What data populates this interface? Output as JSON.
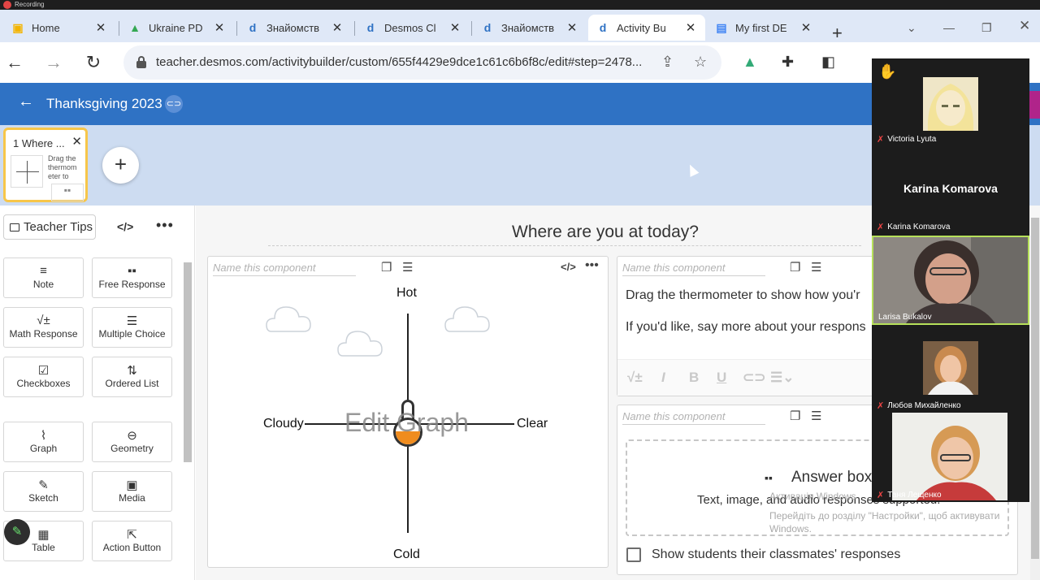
{
  "recording": {
    "label": "Recording"
  },
  "tabs": [
    {
      "label": "Home",
      "favicon": "classroom-icon",
      "color": "#f4b400"
    },
    {
      "label": "Ukraine PD",
      "favicon": "drive-icon",
      "color": "#34a853"
    },
    {
      "label": "Знайомств",
      "favicon": "desmos-icon",
      "color": "#2f72c4"
    },
    {
      "label": "Desmos Cl",
      "favicon": "desmos-icon",
      "color": "#2f72c4"
    },
    {
      "label": "Знайомств",
      "favicon": "desmos-icon",
      "color": "#2f72c4"
    },
    {
      "label": "Activity Bu",
      "favicon": "desmos-icon",
      "color": "#2f72c4",
      "active": true
    },
    {
      "label": "My first DE",
      "favicon": "docs-icon",
      "color": "#4285f4"
    }
  ],
  "browser": {
    "url": "teacher.desmos.com/activitybuilder/custom/655f4429e9dce1c61c6b6f8c/edit#step=2478..."
  },
  "header": {
    "title": "Thanksgiving 2023"
  },
  "screens": [
    {
      "number": "1",
      "title": "Where ...",
      "preview_text": "Drag the thermom eter to"
    }
  ],
  "leftpanel": {
    "teacher_tips": "Teacher Tips",
    "code_icon": "</>",
    "more_icon": "•••",
    "components": [
      {
        "label": "Note",
        "icon": "note-icon",
        "glyph": "≡"
      },
      {
        "label": "Free Response",
        "icon": "free-response-icon",
        "glyph": "▪▪"
      },
      {
        "label": "Math Response",
        "icon": "math-response-icon",
        "glyph": "√±"
      },
      {
        "label": "Multiple Choice",
        "icon": "multiple-choice-icon",
        "glyph": "☰"
      },
      {
        "label": "Checkboxes",
        "icon": "checkboxes-icon",
        "glyph": "☑"
      },
      {
        "label": "Ordered List",
        "icon": "ordered-list-icon",
        "glyph": "⇅"
      },
      {
        "label": "Graph",
        "icon": "graph-icon",
        "glyph": "📈"
      },
      {
        "label": "Geometry",
        "icon": "geometry-icon",
        "glyph": "⊖"
      },
      {
        "label": "Sketch",
        "icon": "sketch-icon",
        "glyph": "✎"
      },
      {
        "label": "Media",
        "icon": "media-icon",
        "glyph": "▣"
      },
      {
        "label": "Table",
        "icon": "table-icon",
        "glyph": "▦"
      },
      {
        "label": "Action Button",
        "icon": "action-button-icon",
        "glyph": "⇱"
      }
    ]
  },
  "main": {
    "question_title": "Where are you at today?",
    "name_placeholder": "Name this component",
    "graph": {
      "label_top": "Hot",
      "label_bottom": "Cold",
      "label_left": "Cloudy",
      "label_right": "Clear",
      "edit_overlay": "Edit Graph"
    },
    "note": {
      "line1": "Drag the thermometer to show how you'r",
      "line2": "If you'd like, say more about your respons"
    },
    "answer_box": {
      "title": "Answer box",
      "subtitle": "Text, image, and audio responses supported."
    },
    "windows_watermark": {
      "line1": "Активація Windows",
      "line2": "Перейдіть до розділу \"Настройки\", щоб активувати",
      "line3": "Windows."
    },
    "show_classmates": "Show students their classmates' responses"
  },
  "zoom": {
    "participants": [
      {
        "name": "Victoria Lyuta",
        "hand_raised": true
      },
      {
        "name": "Karina Komarova",
        "display": "Karina Komarova"
      },
      {
        "name": "Larisa Bukalov",
        "highlight": true
      },
      {
        "name": "Любов Михайленко"
      },
      {
        "name": "Таня Лещенко"
      }
    ]
  }
}
